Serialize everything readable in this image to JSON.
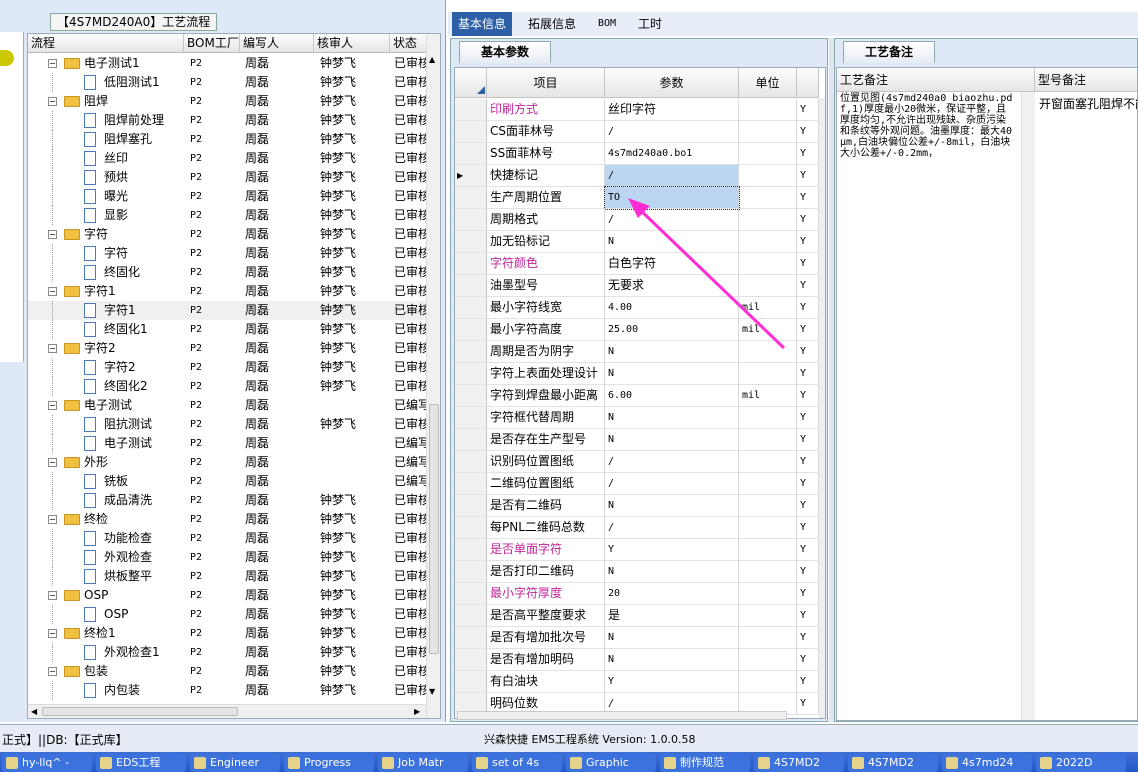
{
  "left": {
    "title": "【4S7MD240A0】工艺流程",
    "columns": [
      "流程",
      "BOM工厂",
      "编写人",
      "核审人",
      "状态"
    ],
    "rows": [
      {
        "name": "电子测试1",
        "bom": "P2",
        "writer": "周磊",
        "reviewer": "钟梦飞",
        "status": "已审核",
        "level": 1,
        "type": "folder"
      },
      {
        "name": "低阻测试1",
        "bom": "P2",
        "writer": "周磊",
        "reviewer": "钟梦飞",
        "status": "已审核",
        "level": 2,
        "type": "doc"
      },
      {
        "name": "阻焊",
        "bom": "P2",
        "writer": "周磊",
        "reviewer": "钟梦飞",
        "status": "已审核",
        "level": 1,
        "type": "folder"
      },
      {
        "name": "阻焊前处理",
        "bom": "P2",
        "writer": "周磊",
        "reviewer": "钟梦飞",
        "status": "已审核",
        "level": 2,
        "type": "doc"
      },
      {
        "name": "阻焊塞孔",
        "bom": "P2",
        "writer": "周磊",
        "reviewer": "钟梦飞",
        "status": "已审核",
        "level": 2,
        "type": "doc"
      },
      {
        "name": "丝印",
        "bom": "P2",
        "writer": "周磊",
        "reviewer": "钟梦飞",
        "status": "已审核",
        "level": 2,
        "type": "doc"
      },
      {
        "name": "预烘",
        "bom": "P2",
        "writer": "周磊",
        "reviewer": "钟梦飞",
        "status": "已审核",
        "level": 2,
        "type": "doc"
      },
      {
        "name": "曝光",
        "bom": "P2",
        "writer": "周磊",
        "reviewer": "钟梦飞",
        "status": "已审核",
        "level": 2,
        "type": "doc"
      },
      {
        "name": "显影",
        "bom": "P2",
        "writer": "周磊",
        "reviewer": "钟梦飞",
        "status": "已审核",
        "level": 2,
        "type": "doc"
      },
      {
        "name": "字符",
        "bom": "P2",
        "writer": "周磊",
        "reviewer": "钟梦飞",
        "status": "已审核",
        "level": 1,
        "type": "folder"
      },
      {
        "name": "字符",
        "bom": "P2",
        "writer": "周磊",
        "reviewer": "钟梦飞",
        "status": "已审核",
        "level": 2,
        "type": "doc"
      },
      {
        "name": "终固化",
        "bom": "P2",
        "writer": "周磊",
        "reviewer": "钟梦飞",
        "status": "已审核",
        "level": 2,
        "type": "doc"
      },
      {
        "name": "字符1",
        "bom": "P2",
        "writer": "周磊",
        "reviewer": "钟梦飞",
        "status": "已审核",
        "level": 1,
        "type": "folder"
      },
      {
        "name": "字符1",
        "bom": "P2",
        "writer": "周磊",
        "reviewer": "钟梦飞",
        "status": "已审核",
        "level": 2,
        "type": "doc",
        "selected": true
      },
      {
        "name": "终固化1",
        "bom": "P2",
        "writer": "周磊",
        "reviewer": "钟梦飞",
        "status": "已审核",
        "level": 2,
        "type": "doc"
      },
      {
        "name": "字符2",
        "bom": "P2",
        "writer": "周磊",
        "reviewer": "钟梦飞",
        "status": "已审核",
        "level": 1,
        "type": "folder"
      },
      {
        "name": "字符2",
        "bom": "P2",
        "writer": "周磊",
        "reviewer": "钟梦飞",
        "status": "已审核",
        "level": 2,
        "type": "doc"
      },
      {
        "name": "终固化2",
        "bom": "P2",
        "writer": "周磊",
        "reviewer": "钟梦飞",
        "status": "已审核",
        "level": 2,
        "type": "doc"
      },
      {
        "name": "电子测试",
        "bom": "P2",
        "writer": "周磊",
        "reviewer": "",
        "status": "已编写",
        "level": 1,
        "type": "folder"
      },
      {
        "name": "阻抗测试",
        "bom": "P2",
        "writer": "周磊",
        "reviewer": "钟梦飞",
        "status": "已审核",
        "level": 2,
        "type": "doc"
      },
      {
        "name": "电子测试",
        "bom": "P2",
        "writer": "周磊",
        "reviewer": "",
        "status": "已编写",
        "level": 2,
        "type": "doc"
      },
      {
        "name": "外形",
        "bom": "P2",
        "writer": "周磊",
        "reviewer": "",
        "status": "已编写",
        "level": 1,
        "type": "folder"
      },
      {
        "name": "铣板",
        "bom": "P2",
        "writer": "周磊",
        "reviewer": "",
        "status": "已编写",
        "level": 2,
        "type": "doc"
      },
      {
        "name": "成品清洗",
        "bom": "P2",
        "writer": "周磊",
        "reviewer": "钟梦飞",
        "status": "已审核",
        "level": 2,
        "type": "doc"
      },
      {
        "name": "终检",
        "bom": "P2",
        "writer": "周磊",
        "reviewer": "钟梦飞",
        "status": "已审核",
        "level": 1,
        "type": "folder"
      },
      {
        "name": "功能检查",
        "bom": "P2",
        "writer": "周磊",
        "reviewer": "钟梦飞",
        "status": "已审核",
        "level": 2,
        "type": "doc"
      },
      {
        "name": "外观检查",
        "bom": "P2",
        "writer": "周磊",
        "reviewer": "钟梦飞",
        "status": "已审核",
        "level": 2,
        "type": "doc"
      },
      {
        "name": "烘板整平",
        "bom": "P2",
        "writer": "周磊",
        "reviewer": "钟梦飞",
        "status": "已审核",
        "level": 2,
        "type": "doc"
      },
      {
        "name": "OSP",
        "bom": "P2",
        "writer": "周磊",
        "reviewer": "钟梦飞",
        "status": "已审核",
        "level": 1,
        "type": "folder"
      },
      {
        "name": "OSP",
        "bom": "P2",
        "writer": "周磊",
        "reviewer": "钟梦飞",
        "status": "已审核",
        "level": 2,
        "type": "doc"
      },
      {
        "name": "终检1",
        "bom": "P2",
        "writer": "周磊",
        "reviewer": "钟梦飞",
        "status": "已审核",
        "level": 1,
        "type": "folder"
      },
      {
        "name": "外观检查1",
        "bom": "P2",
        "writer": "周磊",
        "reviewer": "钟梦飞",
        "status": "已审核",
        "level": 2,
        "type": "doc"
      },
      {
        "name": "包装",
        "bom": "P2",
        "writer": "周磊",
        "reviewer": "钟梦飞",
        "status": "已审核",
        "level": 1,
        "type": "folder"
      },
      {
        "name": "内包装",
        "bom": "P2",
        "writer": "周磊",
        "reviewer": "钟梦飞",
        "status": "已审核",
        "level": 2,
        "type": "doc"
      }
    ]
  },
  "tabs": [
    "基本信息",
    "拓展信息",
    "BOM",
    "工时"
  ],
  "middle": {
    "panel_title": "基本参数",
    "columns": [
      "项目",
      "参数",
      "单位"
    ],
    "rows": [
      {
        "item": "印刷方式",
        "value": "丝印字符",
        "unit": "",
        "flag": "Y",
        "pink": true
      },
      {
        "item": "CS面菲林号",
        "value": "/",
        "unit": "",
        "flag": "Y"
      },
      {
        "item": "SS面菲林号",
        "value": "4s7md240a0.bo1",
        "unit": "",
        "flag": "Y"
      },
      {
        "item": "快捷标记",
        "value": "/",
        "unit": "",
        "flag": "Y",
        "current": true
      },
      {
        "item": "生产周期位置",
        "value": "TO",
        "unit": "",
        "flag": "Y",
        "selected": true
      },
      {
        "item": "周期格式",
        "value": "/",
        "unit": "",
        "flag": "Y"
      },
      {
        "item": "加无铅标记",
        "value": "N",
        "unit": "",
        "flag": "Y"
      },
      {
        "item": "字符颜色",
        "value": "白色字符",
        "unit": "",
        "flag": "Y",
        "pink": true
      },
      {
        "item": "油墨型号",
        "value": "无要求",
        "unit": "",
        "flag": "Y"
      },
      {
        "item": "最小字符线宽",
        "value": "4.00",
        "unit": "mil",
        "flag": "Y"
      },
      {
        "item": "最小字符高度",
        "value": "25.00",
        "unit": "mil",
        "flag": "Y"
      },
      {
        "item": "周期是否为阴字",
        "value": "N",
        "unit": "",
        "flag": "Y"
      },
      {
        "item": "字符上表面处理设计",
        "value": "N",
        "unit": "",
        "flag": "Y"
      },
      {
        "item": "字符到焊盘最小距离",
        "value": "6.00",
        "unit": "mil",
        "flag": "Y"
      },
      {
        "item": "字符框代替周期",
        "value": "N",
        "unit": "",
        "flag": "Y"
      },
      {
        "item": "是否存在生产型号",
        "value": "N",
        "unit": "",
        "flag": "Y"
      },
      {
        "item": "识别码位置图纸",
        "value": "/",
        "unit": "",
        "flag": "Y"
      },
      {
        "item": "二维码位置图纸",
        "value": "/",
        "unit": "",
        "flag": "Y"
      },
      {
        "item": "是否有二维码",
        "value": "N",
        "unit": "",
        "flag": "Y"
      },
      {
        "item": "每PNL二维码总数",
        "value": "/",
        "unit": "",
        "flag": "Y"
      },
      {
        "item": "是否单面字符",
        "value": "Y",
        "unit": "",
        "flag": "Y",
        "pink": true
      },
      {
        "item": "是否打印二维码",
        "value": "N",
        "unit": "",
        "flag": "Y"
      },
      {
        "item": "最小字符厚度",
        "value": "20",
        "unit": "",
        "flag": "Y",
        "pink": true
      },
      {
        "item": "是否高平整度要求",
        "value": "是",
        "unit": "",
        "flag": "Y"
      },
      {
        "item": "是否有增加批次号",
        "value": "N",
        "unit": "",
        "flag": "Y"
      },
      {
        "item": "是否有增加明码",
        "value": "N",
        "unit": "",
        "flag": "Y"
      },
      {
        "item": "有白油块",
        "value": "Y",
        "unit": "",
        "flag": "Y"
      },
      {
        "item": "明码位数",
        "value": "/",
        "unit": "",
        "flag": "Y"
      }
    ]
  },
  "right": {
    "panel_title": "工艺备注",
    "columns": [
      "工艺备注",
      "型号备注"
    ],
    "process_remark": "位置见图(4s7md240a0_biaozhu.pdf,1)厚度最小20微米，保证平整，且厚度均匀,不允许出现残缺、杂质污染和条纹等外观问题。油墨厚度：最大40μm,白油块偏位公差+/-8mil，白油块大小公差+/-0.2mm，",
    "model_remark": "开窗面塞孔阻焊不能"
  },
  "status": {
    "left_text": "正式】||DB:【正式库】",
    "center_text": "兴森快捷 EMS工程系统 Version: 1.0.0.58"
  },
  "taskbar": [
    "hy-llq^ -",
    "EDS工程",
    "Engineer",
    "Progress",
    "Job Matr",
    "set of 4s",
    "Graphic",
    "制作规范",
    "4S7MD2",
    "4S7MD2",
    "4s7md24",
    "2022D"
  ],
  "colors": {
    "accent": "#2d5fa6",
    "pink_label": "#c0259b",
    "arrow": "#ff2bd5",
    "highlight": "#bcd6f2"
  }
}
